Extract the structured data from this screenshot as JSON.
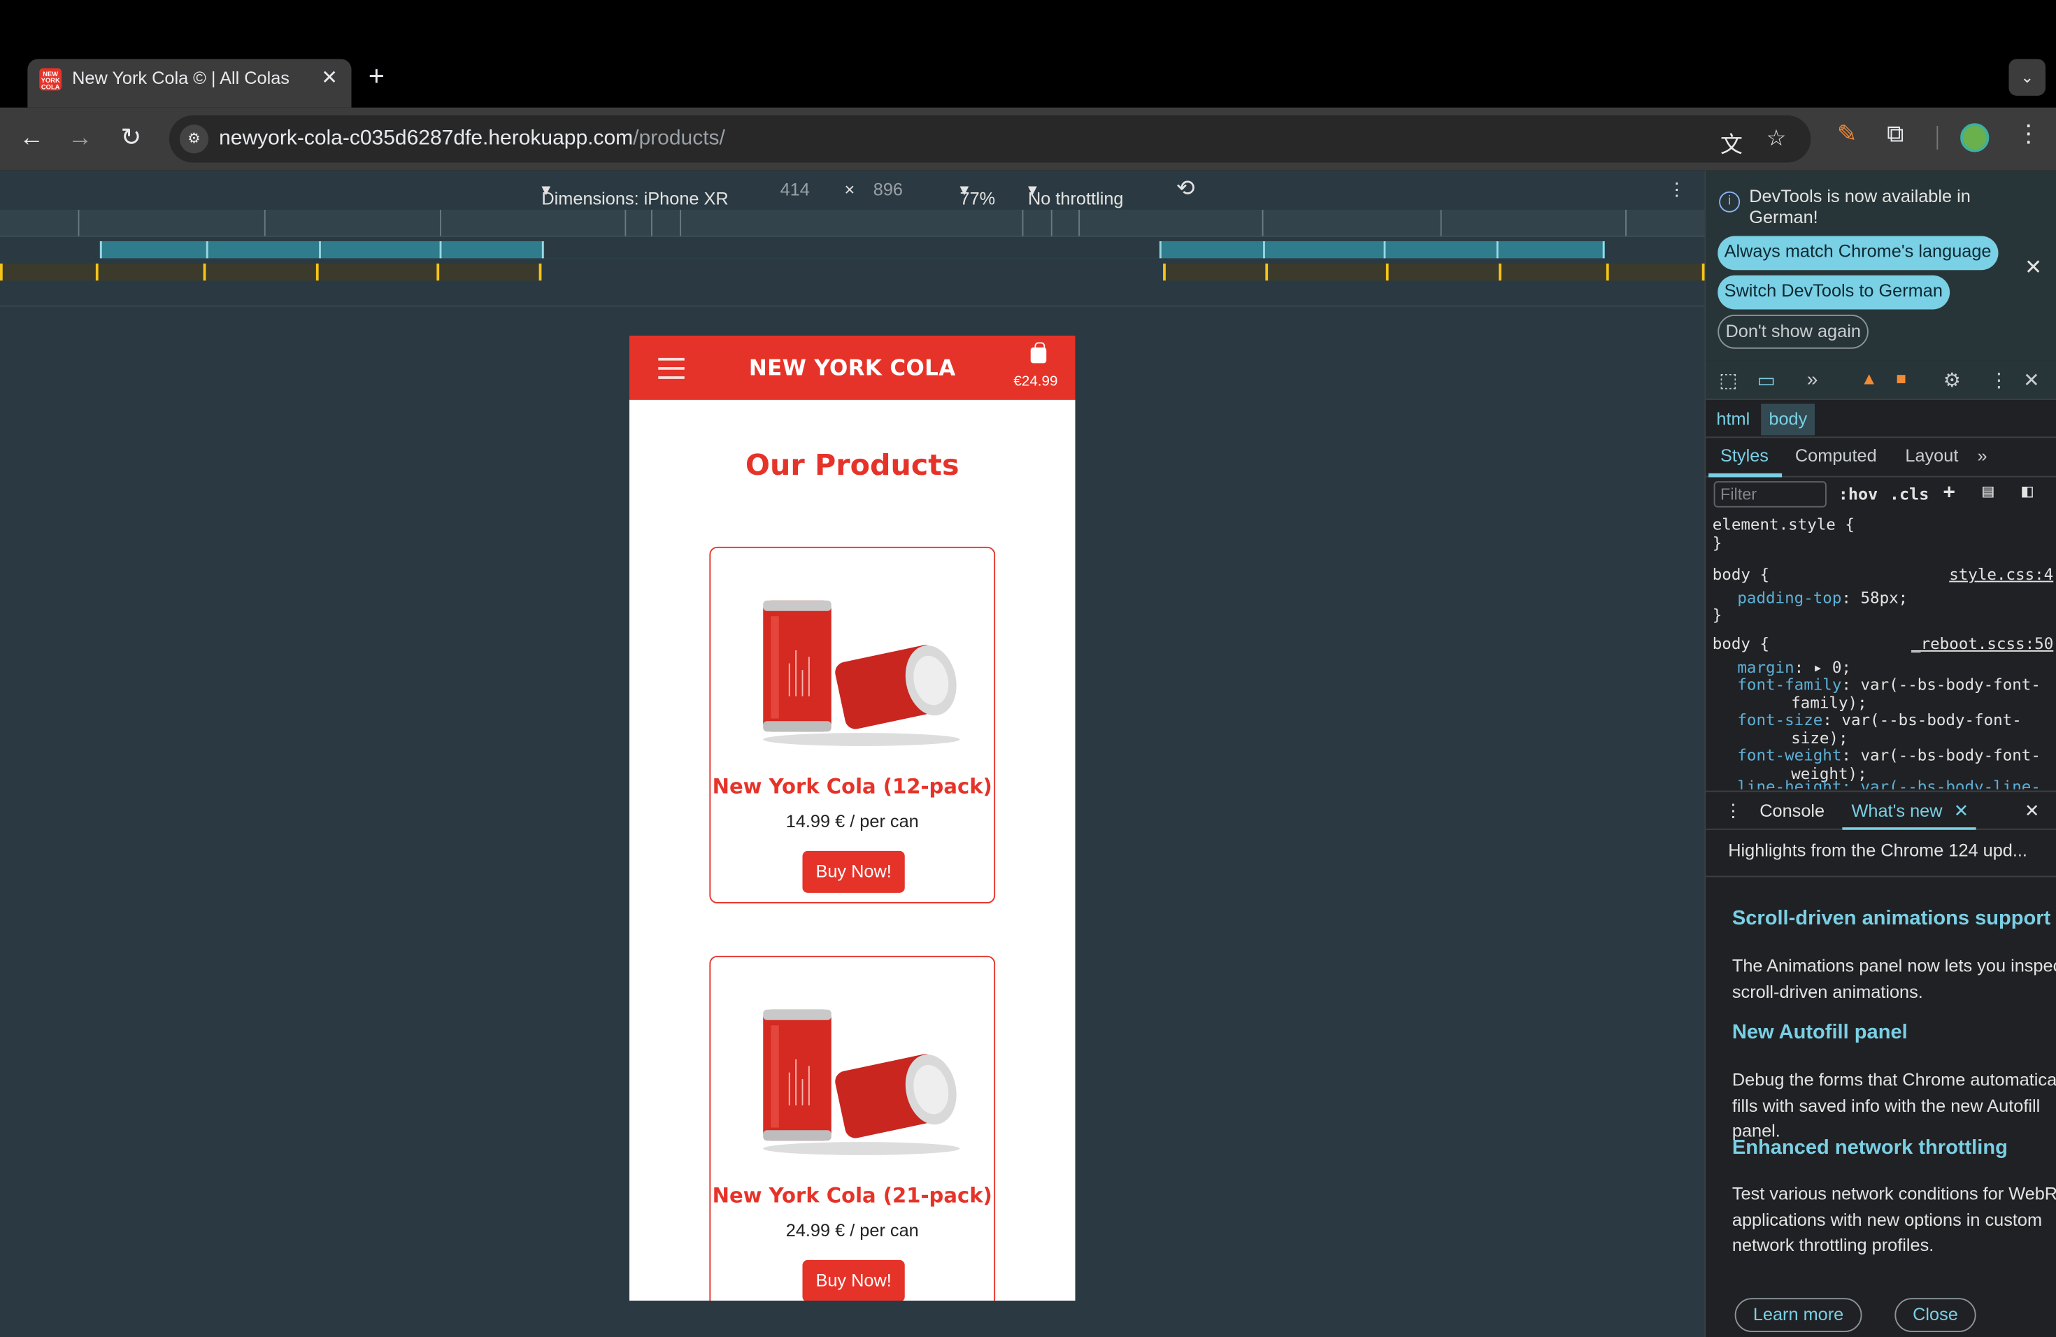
{
  "browser": {
    "tab_title": "New York Cola © | All Colas",
    "favicon_text": "NEW YORK COLA",
    "url_host": "newyork-cola-c035d6287dfe.herokuapp.com",
    "url_path": "/products/"
  },
  "device_toolbar": {
    "device_label": "Dimensions: iPhone XR",
    "width": "414",
    "times": "×",
    "height": "896",
    "zoom": "77%",
    "throttling": "No throttling"
  },
  "site": {
    "brand": "NEW YORK COLA",
    "cart_total": "€24.99",
    "page_title": "Our Products",
    "products": [
      {
        "name": "New York Cola (12-pack)",
        "price": "14.99 € / per can",
        "button": "Buy Now!"
      },
      {
        "name": "New York Cola (21-pack)",
        "price": "24.99 € / per can",
        "button": "Buy Now!"
      }
    ]
  },
  "devtools": {
    "info_text": "DevTools is now available in German!",
    "pill_1": "Always match Chrome's language",
    "pill_2": "Switch DevTools to German",
    "pill_3": "Don't show again",
    "crumbs": [
      "html",
      "body"
    ],
    "subtabs": [
      "Styles",
      "Computed",
      "Layout"
    ],
    "filter_placeholder": "Filter",
    "hov": ":hov",
    "cls": ".cls",
    "css": {
      "element_style": "element.style {",
      "close": "}",
      "body_sel": "body {",
      "src1": "style.css:4",
      "padding_prop": "padding-top",
      "padding_val": ": 58px;",
      "src2": "_reboot.scss:50",
      "margin_prop": "margin",
      "margin_val": ": ▸ 0;",
      "ff_prop": "font-family",
      "ff_val": ": var(--bs-body-font-",
      "ff_val2": "family);",
      "fs_prop": "font-size",
      "fs_val": ": var(--bs-body-font-",
      "fs_val2": "size);",
      "fw_prop": "font-weight",
      "fw_val": ": var(--bs-body-font-",
      "fw_val2": "weight);",
      "lh_partial": "line-height: var(--bs-body-line-"
    },
    "drawer_tabs": [
      "Console",
      "What's new"
    ],
    "whats_new": {
      "header": "Highlights from the Chrome 124 upd...",
      "h1": "Scroll-driven animations support",
      "p1": "The Animations panel now lets you inspect scroll-driven animations.",
      "h2": "New Autofill panel",
      "p2": "Debug the forms that Chrome automatically fills with saved info with the new Autofill panel.",
      "h3": "Enhanced network throttling",
      "p3": "Test various network conditions for WebRTC applications with new options in custom network throttling profiles.",
      "learn_more": "Learn more",
      "close": "Close"
    }
  },
  "colors": {
    "brand_red": "#e63329",
    "devtools_accent": "#7ad0e5"
  }
}
